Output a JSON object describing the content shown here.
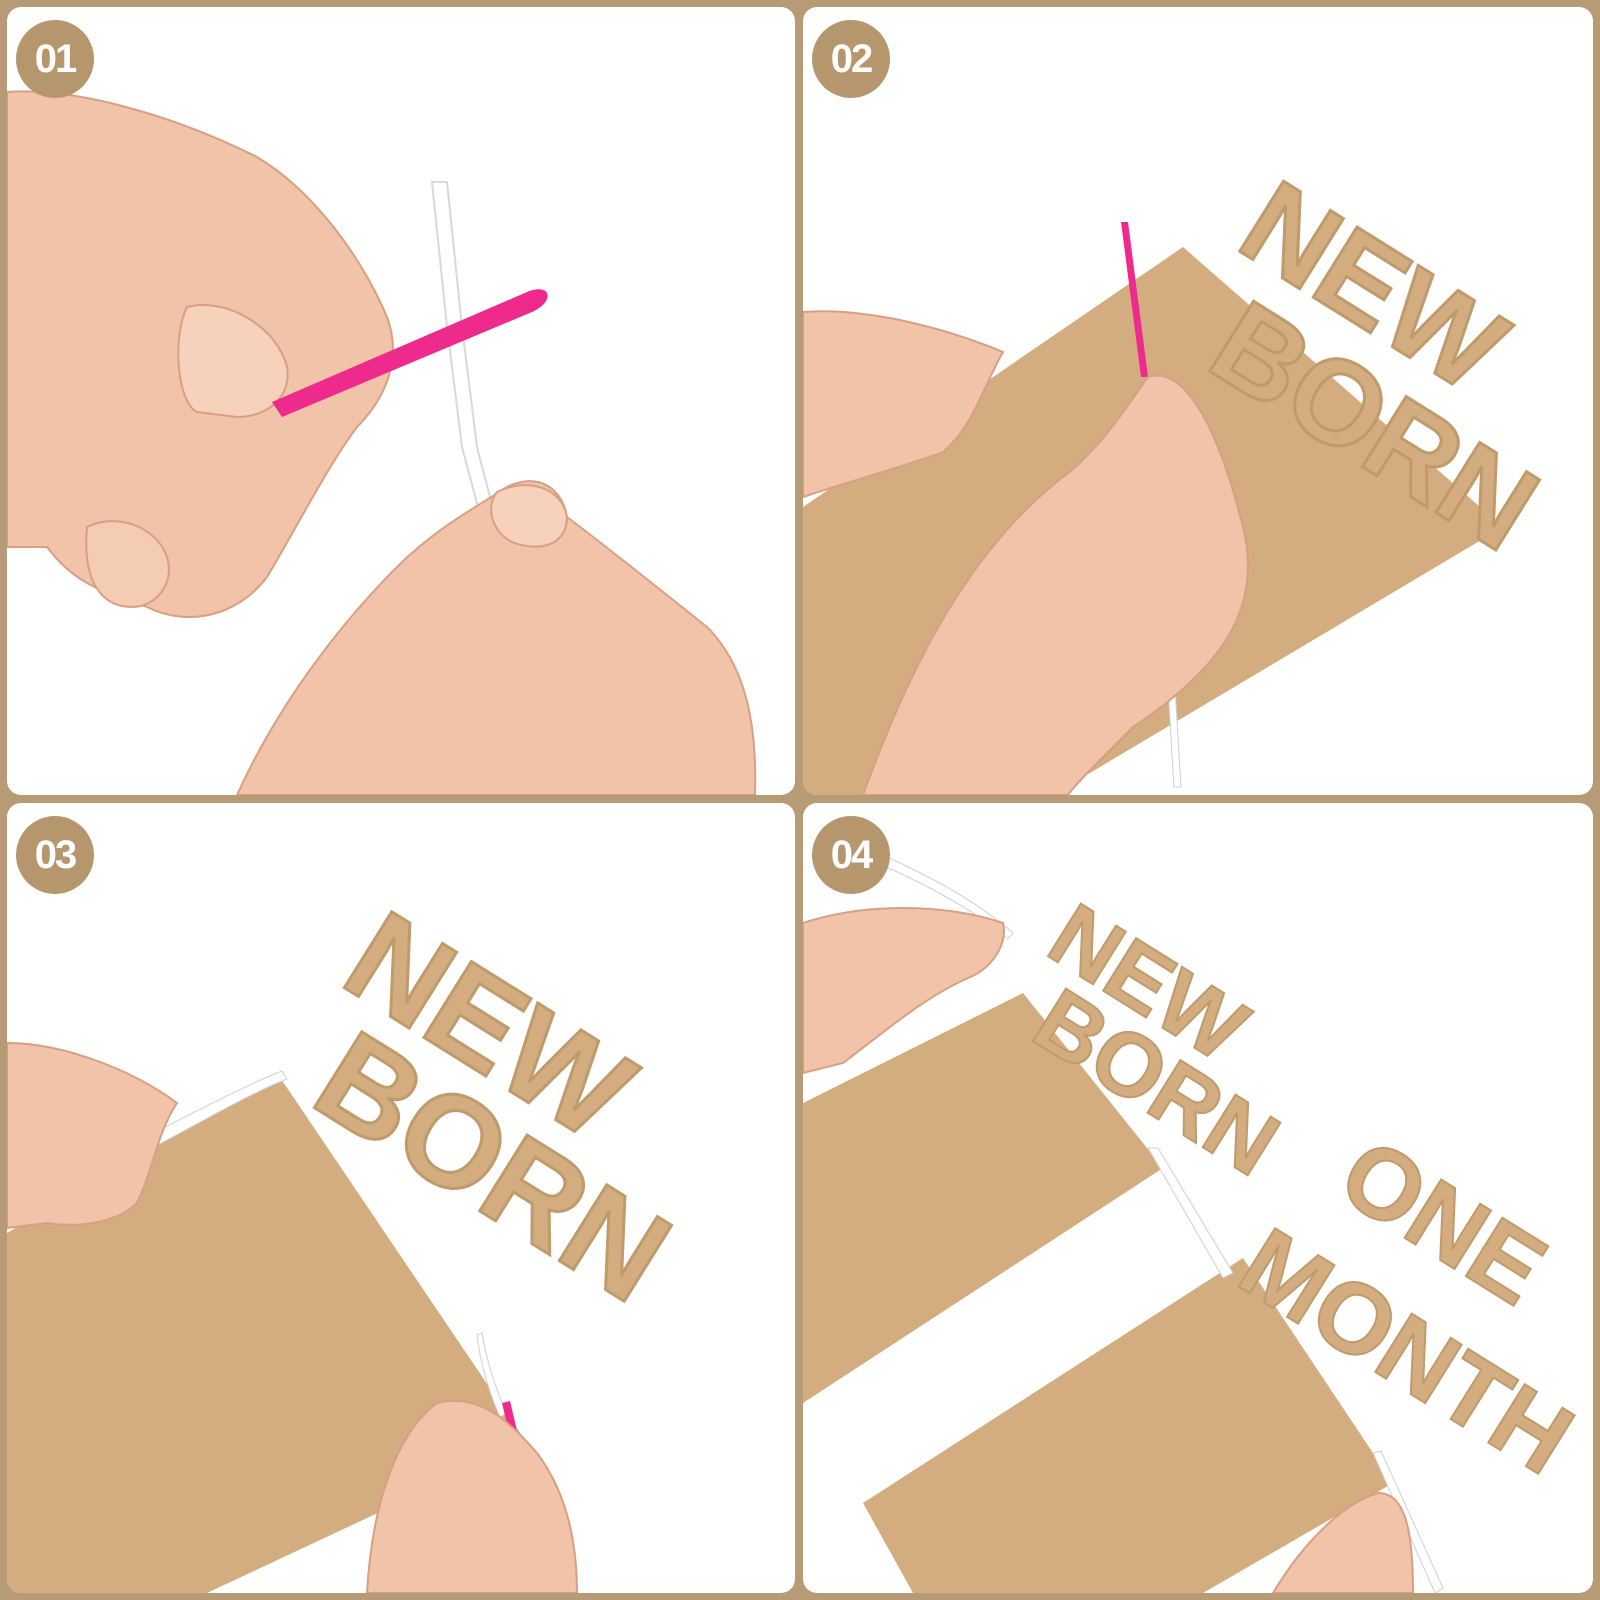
{
  "steps": [
    {
      "number": "01"
    },
    {
      "number": "02"
    },
    {
      "number": "03"
    },
    {
      "number": "04"
    }
  ],
  "banner_words": [
    "NEW",
    "BORN",
    "ONE",
    "MONTH"
  ],
  "colors": {
    "frame": "#b79a76",
    "badge": "#b6966d",
    "kraft": "#d3ad7f",
    "kraft_shadow": "#bf9a6b",
    "needle": "#ee2a8c",
    "ribbon": "#ffffff",
    "skin": "#f2c7ae"
  }
}
